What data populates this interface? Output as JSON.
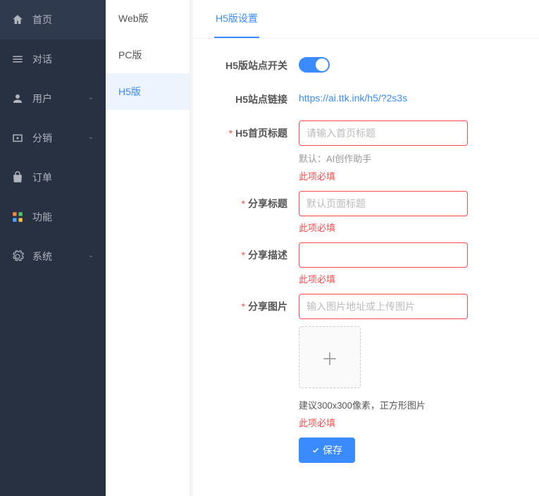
{
  "sidebar": {
    "items": [
      {
        "label": "首页",
        "icon": "home",
        "expandable": false
      },
      {
        "label": "对话",
        "icon": "list",
        "expandable": false
      },
      {
        "label": "用户",
        "icon": "user",
        "expandable": true
      },
      {
        "label": "分销",
        "icon": "affiliate",
        "expandable": true
      },
      {
        "label": "订单",
        "icon": "bag",
        "expandable": false
      },
      {
        "label": "功能",
        "icon": "grid",
        "expandable": false
      },
      {
        "label": "系统",
        "icon": "gear",
        "expandable": true
      }
    ]
  },
  "subnav": {
    "items": [
      {
        "label": "Web版",
        "active": false
      },
      {
        "label": "PC版",
        "active": false
      },
      {
        "label": "H5版",
        "active": true
      }
    ]
  },
  "tab": {
    "label": "H5版设置"
  },
  "form": {
    "switch": {
      "label": "H5版站点开关",
      "on": true
    },
    "link": {
      "label": "H5站点链接",
      "url": "https://ai.ttk.ink/h5/?2s3s"
    },
    "home_title": {
      "label": "H5首页标题",
      "placeholder": "请输入首页标题",
      "help": "默认：AI创作助手",
      "error": "此项必填"
    },
    "share_title": {
      "label": "分享标题",
      "placeholder": "默认页面标题",
      "error": "此项必填"
    },
    "share_desc": {
      "label": "分享描述",
      "placeholder": "",
      "error": "此项必填"
    },
    "share_image": {
      "label": "分享图片",
      "placeholder": "输入图片地址或上传图片",
      "note": "建议300x300像素，正方形图片",
      "error": "此项必填"
    },
    "save": "保存"
  }
}
